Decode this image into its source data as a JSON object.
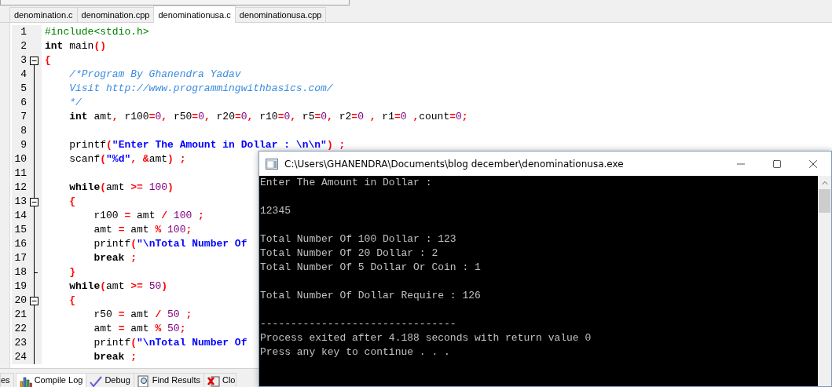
{
  "editor_tabs": [
    {
      "label": "denomination.c",
      "selected": false
    },
    {
      "label": "denomination.cpp",
      "selected": false
    },
    {
      "label": "denominationusa.c",
      "selected": true
    },
    {
      "label": "denominationusa.cpp",
      "selected": false
    }
  ],
  "code_lines": [
    {
      "number": "1",
      "kind": "code",
      "tokens": [
        {
          "kind": "preproc",
          "text": "#include<stdio.h>"
        }
      ]
    },
    {
      "number": "2",
      "kind": "code",
      "tokens": [
        {
          "kind": "keyword",
          "text": "int"
        },
        {
          "kind": "plain",
          "text": " main"
        },
        {
          "kind": "op",
          "text": "()"
        }
      ]
    },
    {
      "number": "3",
      "kind": "fold_start",
      "tokens": [
        {
          "kind": "op",
          "text": "{"
        }
      ]
    },
    {
      "number": "4",
      "kind": "code",
      "tokens": [
        {
          "kind": "comment",
          "text": "    /*Program By Ghanendra Yadav"
        }
      ]
    },
    {
      "number": "5",
      "kind": "code",
      "tokens": [
        {
          "kind": "comment",
          "text": "    Visit http://www.programmingwithbasics.com/"
        }
      ]
    },
    {
      "number": "6",
      "kind": "code",
      "tokens": [
        {
          "kind": "comment",
          "text": "    */"
        }
      ]
    },
    {
      "number": "7",
      "kind": "code",
      "tokens": [
        {
          "kind": "keyword",
          "text": "    int"
        },
        {
          "kind": "plain",
          "text": " amt"
        },
        {
          "kind": "op",
          "text": ","
        },
        {
          "kind": "plain",
          "text": " r100"
        },
        {
          "kind": "op",
          "text": "="
        },
        {
          "kind": "number",
          "text": "0"
        },
        {
          "kind": "op",
          "text": ","
        },
        {
          "kind": "plain",
          "text": " r50"
        },
        {
          "kind": "op",
          "text": "="
        },
        {
          "kind": "number",
          "text": "0"
        },
        {
          "kind": "op",
          "text": ","
        },
        {
          "kind": "plain",
          "text": " r20"
        },
        {
          "kind": "op",
          "text": "="
        },
        {
          "kind": "number",
          "text": "0"
        },
        {
          "kind": "op",
          "text": ","
        },
        {
          "kind": "plain",
          "text": " r10"
        },
        {
          "kind": "op",
          "text": "="
        },
        {
          "kind": "number",
          "text": "0"
        },
        {
          "kind": "op",
          "text": ","
        },
        {
          "kind": "plain",
          "text": " r5"
        },
        {
          "kind": "op",
          "text": "="
        },
        {
          "kind": "number",
          "text": "0"
        },
        {
          "kind": "op",
          "text": ","
        },
        {
          "kind": "plain",
          "text": " r2"
        },
        {
          "kind": "op",
          "text": "="
        },
        {
          "kind": "number",
          "text": "0"
        },
        {
          "kind": "op",
          "text": " ,"
        },
        {
          "kind": "plain",
          "text": " r1"
        },
        {
          "kind": "op",
          "text": "="
        },
        {
          "kind": "number",
          "text": "0"
        },
        {
          "kind": "op",
          "text": " ,"
        },
        {
          "kind": "plain",
          "text": "count"
        },
        {
          "kind": "op",
          "text": "="
        },
        {
          "kind": "number",
          "text": "0"
        },
        {
          "kind": "op",
          "text": ";"
        }
      ]
    },
    {
      "number": "8",
      "kind": "code"
    },
    {
      "number": "9",
      "kind": "code",
      "tokens": [
        {
          "kind": "plain",
          "text": "    printf"
        },
        {
          "kind": "op",
          "text": "("
        },
        {
          "kind": "string",
          "text": "\"Enter The Amount in Dollar : \\n\\n\""
        },
        {
          "kind": "op",
          "text": ")"
        },
        {
          "kind": "op",
          "text": " ;"
        }
      ]
    },
    {
      "number": "10",
      "kind": "code",
      "tokens": [
        {
          "kind": "plain",
          "text": "    scanf"
        },
        {
          "kind": "op",
          "text": "("
        },
        {
          "kind": "string",
          "text": "\"%d\""
        },
        {
          "kind": "op",
          "text": ","
        },
        {
          "kind": "op",
          "text": " &"
        },
        {
          "kind": "plain",
          "text": "amt"
        },
        {
          "kind": "op",
          "text": ")"
        },
        {
          "kind": "op",
          "text": " ;"
        }
      ]
    },
    {
      "number": "11",
      "kind": "code"
    },
    {
      "number": "12",
      "kind": "code",
      "tokens": [
        {
          "kind": "keyword",
          "text": "    while"
        },
        {
          "kind": "op",
          "text": "("
        },
        {
          "kind": "plain",
          "text": "amt "
        },
        {
          "kind": "op",
          "text": ">="
        },
        {
          "kind": "number",
          "text": " 100"
        },
        {
          "kind": "op",
          "text": ")"
        }
      ]
    },
    {
      "number": "13",
      "kind": "fold_start",
      "tokens": [
        {
          "kind": "op",
          "text": "    {"
        }
      ]
    },
    {
      "number": "14",
      "kind": "code",
      "tokens": [
        {
          "kind": "plain",
          "text": "        r100 "
        },
        {
          "kind": "op",
          "text": "="
        },
        {
          "kind": "plain",
          "text": " amt "
        },
        {
          "kind": "op",
          "text": "/"
        },
        {
          "kind": "number",
          "text": " 100"
        },
        {
          "kind": "op",
          "text": " ;"
        }
      ]
    },
    {
      "number": "15",
      "kind": "code",
      "tokens": [
        {
          "kind": "plain",
          "text": "        amt "
        },
        {
          "kind": "op",
          "text": "="
        },
        {
          "kind": "plain",
          "text": " amt "
        },
        {
          "kind": "op",
          "text": "%"
        },
        {
          "kind": "number",
          "text": " 100"
        },
        {
          "kind": "op",
          "text": ";"
        }
      ]
    },
    {
      "number": "16",
      "kind": "code",
      "tokens": [
        {
          "kind": "plain",
          "text": "        printf"
        },
        {
          "kind": "op",
          "text": "("
        },
        {
          "kind": "string",
          "text": "\"\\nTotal Number Of"
        }
      ]
    },
    {
      "number": "17",
      "kind": "code",
      "tokens": [
        {
          "kind": "keyword",
          "text": "        break"
        },
        {
          "kind": "op",
          "text": " ;"
        }
      ]
    },
    {
      "number": "18",
      "kind": "fold_end",
      "tokens": [
        {
          "kind": "op",
          "text": "    }"
        }
      ]
    },
    {
      "number": "19",
      "kind": "code",
      "tokens": [
        {
          "kind": "keyword",
          "text": "    while"
        },
        {
          "kind": "op",
          "text": "("
        },
        {
          "kind": "plain",
          "text": "amt "
        },
        {
          "kind": "op",
          "text": ">="
        },
        {
          "kind": "number",
          "text": " 50"
        },
        {
          "kind": "op",
          "text": ")"
        }
      ]
    },
    {
      "number": "20",
      "kind": "fold_start",
      "tokens": [
        {
          "kind": "op",
          "text": "    {"
        }
      ]
    },
    {
      "number": "21",
      "kind": "code",
      "tokens": [
        {
          "kind": "plain",
          "text": "        r50 "
        },
        {
          "kind": "op",
          "text": "="
        },
        {
          "kind": "plain",
          "text": " amt "
        },
        {
          "kind": "op",
          "text": "/"
        },
        {
          "kind": "number",
          "text": " 50"
        },
        {
          "kind": "op",
          "text": " ;"
        }
      ]
    },
    {
      "number": "22",
      "kind": "code",
      "tokens": [
        {
          "kind": "plain",
          "text": "        amt "
        },
        {
          "kind": "op",
          "text": "="
        },
        {
          "kind": "plain",
          "text": " amt "
        },
        {
          "kind": "op",
          "text": "%"
        },
        {
          "kind": "number",
          "text": " 50"
        },
        {
          "kind": "op",
          "text": ";"
        }
      ]
    },
    {
      "number": "23",
      "kind": "code",
      "tokens": [
        {
          "kind": "plain",
          "text": "        printf"
        },
        {
          "kind": "op",
          "text": "("
        },
        {
          "kind": "string",
          "text": "\"\\nTotal Number Of"
        }
      ]
    },
    {
      "number": "24",
      "kind": "code",
      "tokens": [
        {
          "kind": "keyword",
          "text": "        break"
        },
        {
          "kind": "op",
          "text": " ;"
        }
      ]
    }
  ],
  "bottom_tabs": [
    {
      "label": "es",
      "selected": false
    },
    {
      "label": "Compile Log",
      "selected": true
    },
    {
      "label": "Debug",
      "selected": false
    },
    {
      "label": "Find Results",
      "selected": false
    },
    {
      "label": "Clo",
      "selected": false
    }
  ],
  "console": {
    "title": "C:\\Users\\GHANENDRA\\Documents\\blog december\\denominationusa.exe",
    "blocks": [
      [
        "Enter The Amount in Dollar :"
      ],
      [
        "12345"
      ],
      [
        "Total Number Of 100 Dollar : 123",
        "Total Number Of 20 Dollar : 2",
        "Total Number Of 5 Dollar Or Coin : 1"
      ],
      [
        "Total Number Of Dollar Require : 126"
      ],
      [
        "--------------------------------",
        "Process exited after 4.188 seconds with return value 0",
        "Press any key to continue . . ."
      ]
    ]
  }
}
